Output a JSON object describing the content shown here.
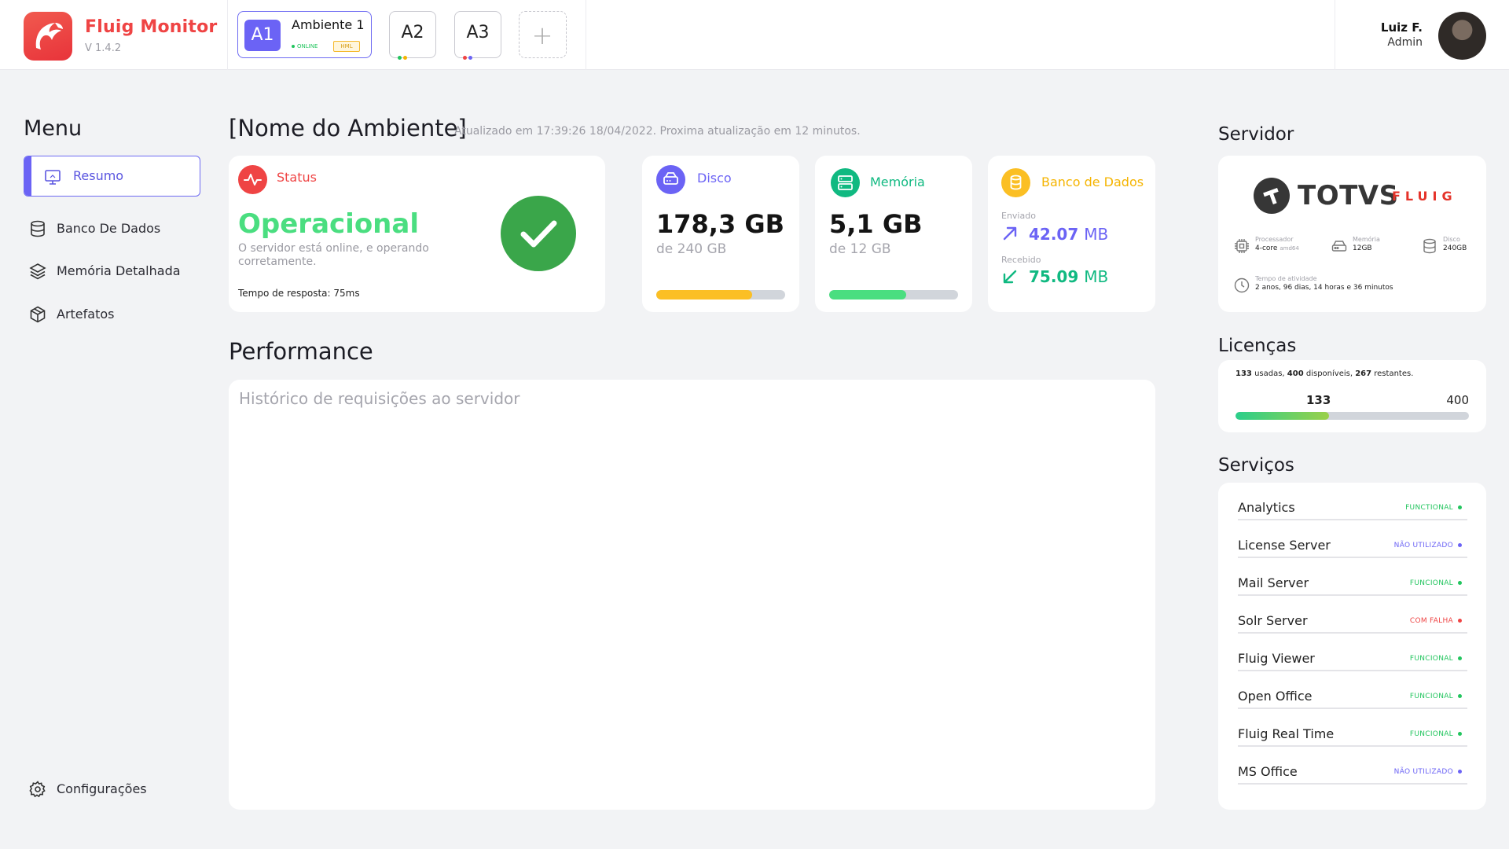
{
  "app": {
    "name": "Fluig Monitor",
    "version": "V 1.4.2"
  },
  "environments": {
    "a1": {
      "badge": "A1",
      "name": "Ambiente 1",
      "status": "ONLINE",
      "tag": "HML"
    },
    "a2": {
      "label": "A2",
      "dots": [
        "#22c55e",
        "#f5b400"
      ]
    },
    "a3": {
      "label": "A3",
      "dots": [
        "#ef4444",
        "#6b63f5"
      ]
    },
    "add_label": "+"
  },
  "user": {
    "name": "Luiz F.",
    "role": "Admin"
  },
  "sidebar": {
    "title": "Menu",
    "items": [
      {
        "label": "Resumo",
        "icon": "monitor-icon",
        "active": true
      },
      {
        "label": "Banco De Dados",
        "icon": "database-icon"
      },
      {
        "label": "Memória Detalhada",
        "icon": "layers-icon"
      },
      {
        "label": "Artefatos",
        "icon": "box-icon"
      }
    ],
    "settings_label": "Configurações"
  },
  "main": {
    "title": "[Nome do Ambiente]",
    "subtitle": "Atualizado em 17:39:26 18/04/2022. Proxima atualização em 12 minutos.",
    "status": {
      "label": "Status",
      "value": "Operacional",
      "description": "O servidor está online, e operando corretamente.",
      "response_time": "Tempo de resposta: 75ms"
    },
    "disco": {
      "label": "Disco",
      "value": "178,3 GB",
      "total": "de 240 GB",
      "usage": 0.743,
      "color": "#fbbf24"
    },
    "memoria": {
      "label": "Memória",
      "value": "5,1 GB",
      "total": "de 12 GB",
      "usage": 0.6,
      "color": "#4ade80"
    },
    "banco": {
      "label": "Banco de Dados",
      "sent_label": "Enviado",
      "sent_value": "42.07",
      "sent_unit": "MB",
      "received_label": "Recebido",
      "received_value": "75.09",
      "received_unit": "MB"
    },
    "performance": {
      "title": "Performance",
      "placeholder": "Histórico de requisições ao servidor"
    }
  },
  "servidor": {
    "title": "Servidor",
    "logo_text": "TOTVS",
    "logo_sub": "FLUIG",
    "specs": {
      "processor": {
        "label": "Processador",
        "value": "4-core",
        "extra": "amd64"
      },
      "memory": {
        "label": "Memória",
        "value": "12GB"
      },
      "disk": {
        "label": "Disco",
        "value": "240GB"
      },
      "uptime": {
        "label": "Tempo de atividade",
        "value": "2 anos, 96 dias, 14 horas e 36 minutos"
      }
    }
  },
  "licencas": {
    "title": "Licenças",
    "used": "133",
    "available": "400",
    "remaining": "267",
    "used_text": "usadas,",
    "available_text": "disponíveis,",
    "remaining_text": "restantes.",
    "total_label": "400",
    "fraction": 0.4
  },
  "servicos": {
    "title": "Serviços",
    "items": [
      {
        "name": "Analytics",
        "status": "FUNCTIONAL",
        "color": "#22c55e"
      },
      {
        "name": "License Server",
        "status": "NÃO UTILIZADO",
        "color": "#6b63f5"
      },
      {
        "name": "Mail Server",
        "status": "FUNCIONAL",
        "color": "#22c55e"
      },
      {
        "name": "Solr Server",
        "status": "COM FALHA",
        "color": "#ef4444"
      },
      {
        "name": "Fluig Viewer",
        "status": "FUNCIONAL",
        "color": "#22c55e"
      },
      {
        "name": "Open Office",
        "status": "FUNCIONAL",
        "color": "#22c55e"
      },
      {
        "name": "Fluig Real Time",
        "status": "FUNCIONAL",
        "color": "#22c55e"
      },
      {
        "name": "MS Office",
        "status": "NÃO UTILIZADO",
        "color": "#6b63f5"
      }
    ]
  }
}
